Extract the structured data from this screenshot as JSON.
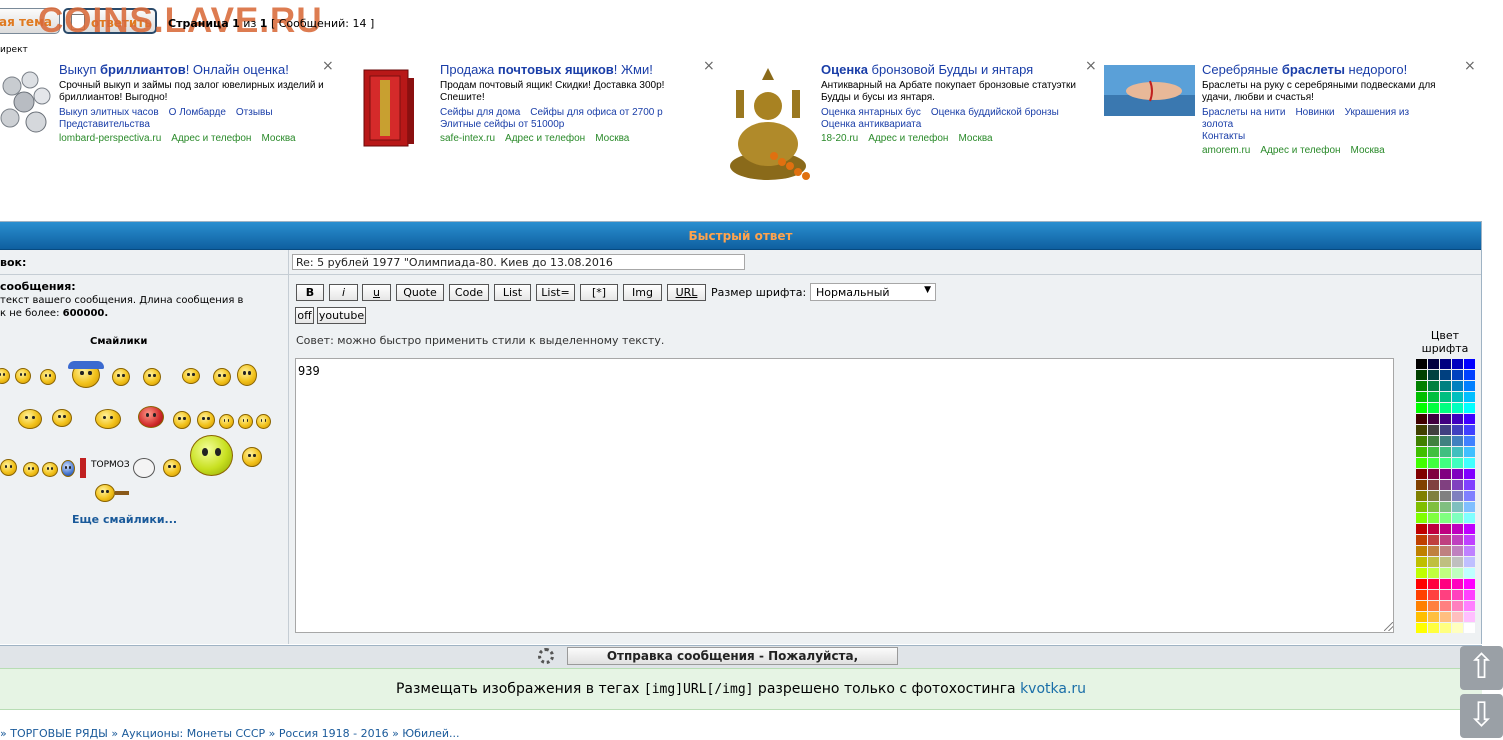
{
  "topbar": {
    "new_topic_label": "ая тема",
    "reply_label": "ответить",
    "watermark": "COINS.LAVE.RU",
    "pages_prefix": "Страница",
    "page_current": "1",
    "pages_of": "из",
    "page_total": "1",
    "posts_text": "[ Сообщений: 14 ]"
  },
  "direct_label": "ирект",
  "ads": [
    {
      "title_pre": "Выкуп ",
      "title_bold": "бриллиантов",
      "title_post": "! Онлайн оценка!",
      "desc": "Срочный выкуп и займы под залог ювелирных изделий и бриллиантов! Выгодно!",
      "links": [
        "Выкуп элитных часов",
        "О Ломбарде",
        "Отзывы",
        "Представительства"
      ],
      "domain": "lombard-perspectiva.ru",
      "meta": [
        "Адрес и телефон",
        "Москва"
      ],
      "close": "×"
    },
    {
      "title_pre": "Продажа ",
      "title_bold": "почтовых ящиков",
      "title_post": "! Жми!",
      "desc": "Продам почтовый ящик! Скидки! Доставка 300р! Спешите!",
      "links": [
        "Сейфы для дома",
        "Сейфы для офиса от 2700 р",
        "Элитные сейфы от 51000р"
      ],
      "domain": "safe-intex.ru",
      "meta": [
        "Адрес и телефон",
        "Москва"
      ],
      "close": "×"
    },
    {
      "title_pre": "",
      "title_bold": "Оценка",
      "title_post": " бронзовой Будды и янтаря",
      "desc": "Антикварный на Арбате покупает бронзовые статуэтки Будды и бусы из янтаря.",
      "links": [
        "Оценка янтарных бус",
        "Оценка буддийской бронзы",
        "Оценка антиквариата"
      ],
      "domain": "18-20.ru",
      "meta": [
        "Адрес и телефон",
        "Москва"
      ],
      "close": "×"
    },
    {
      "title_pre": "Серебряные ",
      "title_bold": "браслеты",
      "title_post": " недорого!",
      "desc": "Браслеты на руку с серебряными подвесками для удачи, любви и счастья!",
      "links": [
        "Браслеты на нити",
        "Новинки",
        "Украшения из золота",
        "Контакты"
      ],
      "domain": "amorem.ru",
      "meta": [
        "Адрес и телефон",
        "Москва"
      ],
      "close": "×"
    }
  ],
  "quickreply": {
    "header": "Быстрый ответ",
    "subject_label": "вок:",
    "subject_value": "Re: 5 рублей 1977 \"Олимпиада-80. Киев до 13.08.2016",
    "message_label": "сообщения:",
    "message_hint_1": " текст вашего сообщения. Длина сообщения в",
    "message_hint_2": "к не более: ",
    "message_limit": "600000.",
    "smilies_title": "Смайлики",
    "more_smilies": "Еще смайлики...",
    "tormoz": "ТОРМОЗ",
    "format_buttons": [
      "B",
      "i",
      "u",
      "Quote",
      "Code",
      "List",
      "List=",
      "[*]",
      "Img",
      "URL"
    ],
    "font_size_label": "Размер шрифта:",
    "font_size_value": "Нормальный",
    "extra_buttons": [
      "off",
      "youtube"
    ],
    "tip": "Совет: можно быстро применить стили к выделенному тексту.",
    "message_text": "939",
    "color_label_1": "Цвет",
    "color_label_2": "шрифта",
    "submit_label": "Отправка сообщения - Пожалуйста, подождите ..."
  },
  "notice": {
    "text_pre": "Размещать изображения в тегах ",
    "tag": "[img]URL[/img]",
    "text_mid": " разрешено только с фотохостинга ",
    "link": "kvotka.ru"
  },
  "footer_text": "» ТОРГОВЫЕ РЯДЫ » Аукционы: Монеты СССР » Россия 1918 - 2016 » Юбилей..."
}
